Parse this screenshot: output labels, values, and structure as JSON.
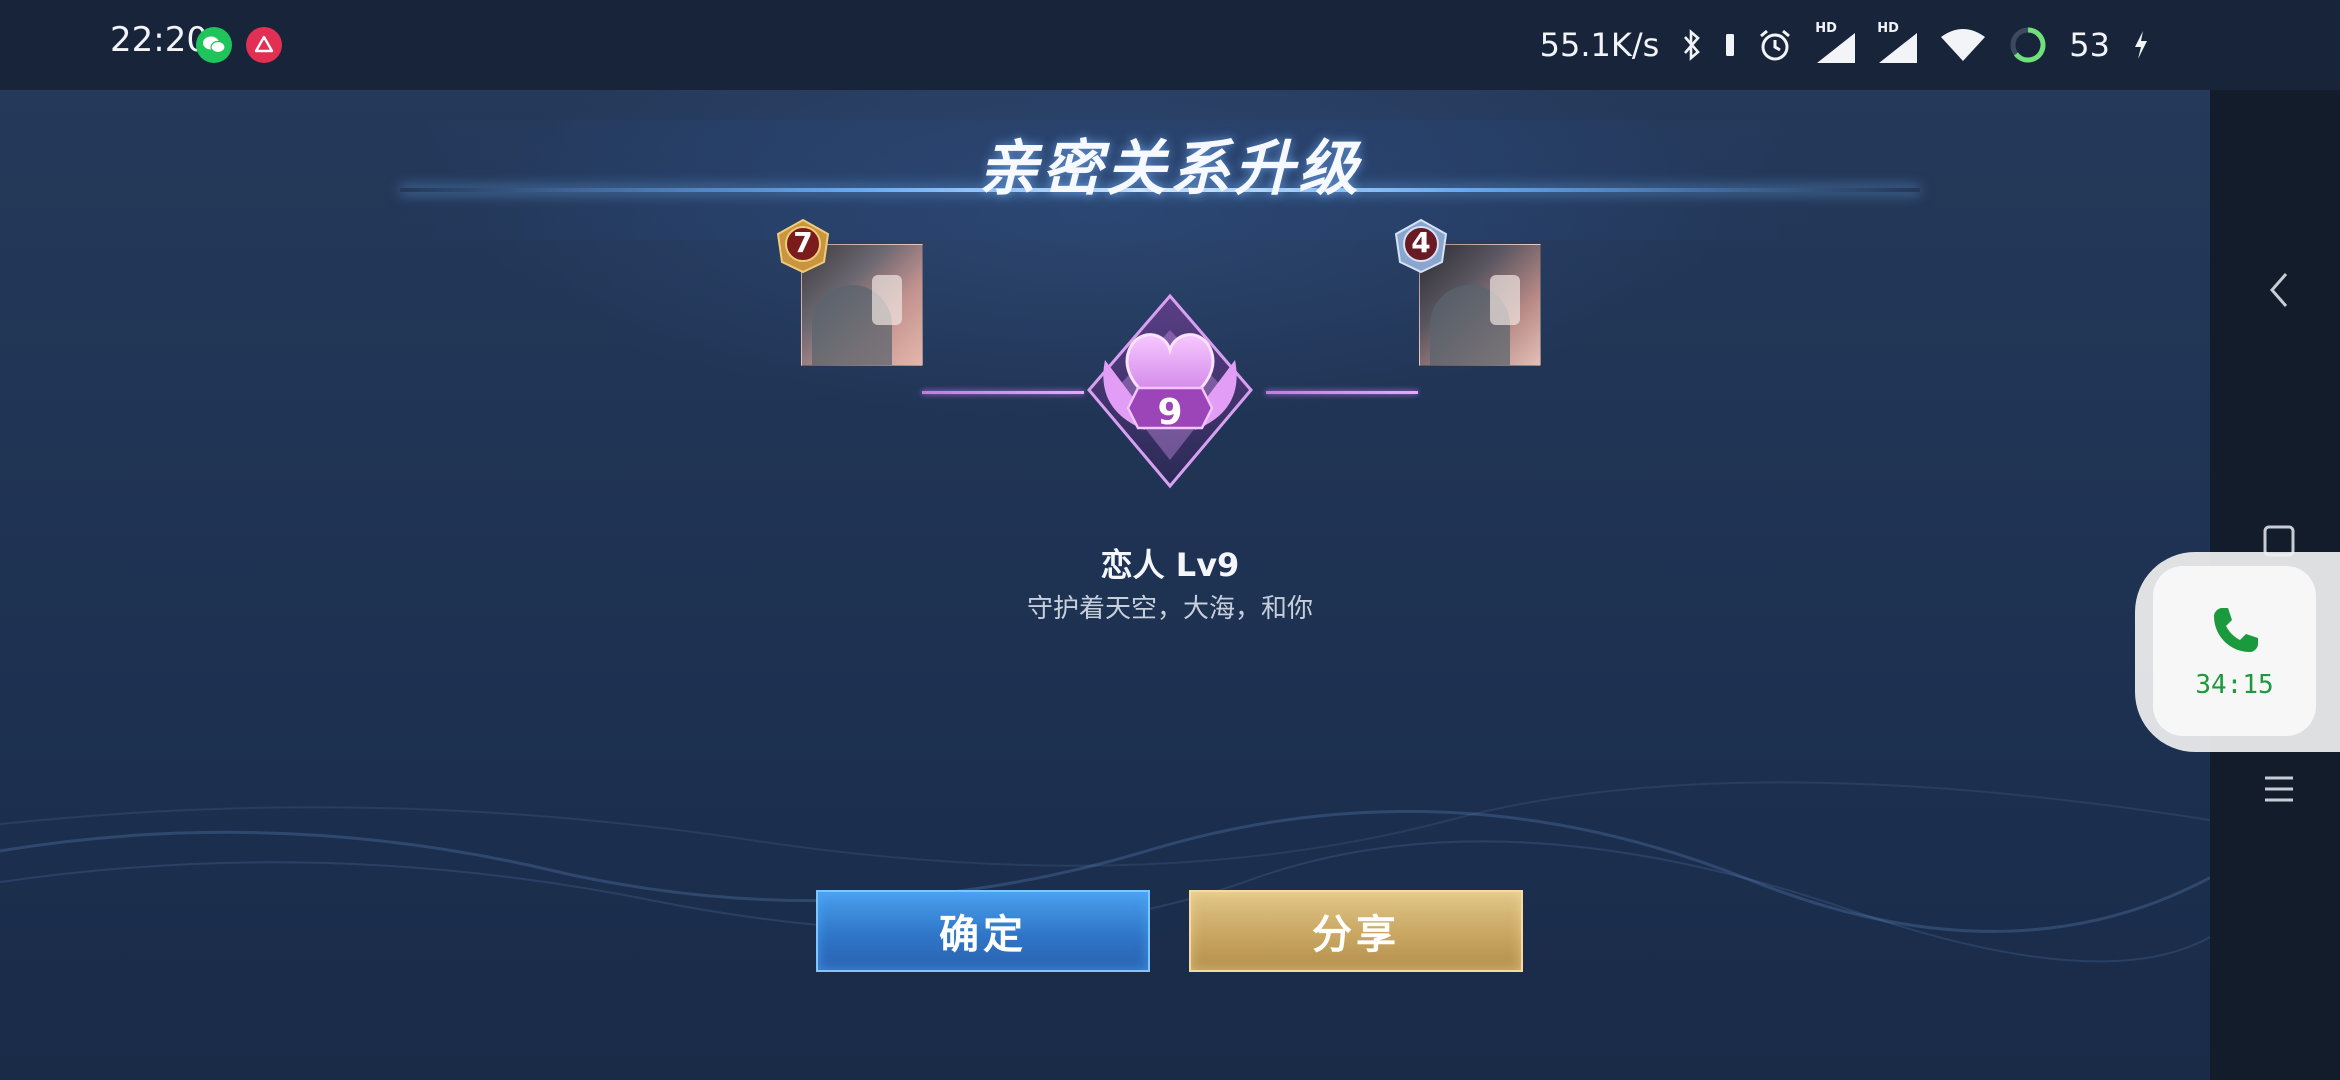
{
  "status_bar": {
    "time": "22:20",
    "apps": [
      "wechat-icon",
      "app-notification-icon"
    ],
    "network_speed": "55.1K/s",
    "hd1": "HD",
    "hd2": "HD",
    "battery_level": "53"
  },
  "screen": {
    "title": "亲密关系升级",
    "left_user_badge": "7",
    "right_user_badge": "4",
    "intimacy_level": "9",
    "relation_title": "恋人 Lv9",
    "relation_subtitle": "守护着天空，大海，和你",
    "confirm_label": "确定",
    "share_label": "分享"
  },
  "call_bubble": {
    "duration": "34:15"
  },
  "colors": {
    "background": "#1f3252",
    "confirm_button": "#3a86d8",
    "share_button": "#c9a661",
    "emblem": "#d88ff0",
    "call_green": "#1a9a3c"
  }
}
